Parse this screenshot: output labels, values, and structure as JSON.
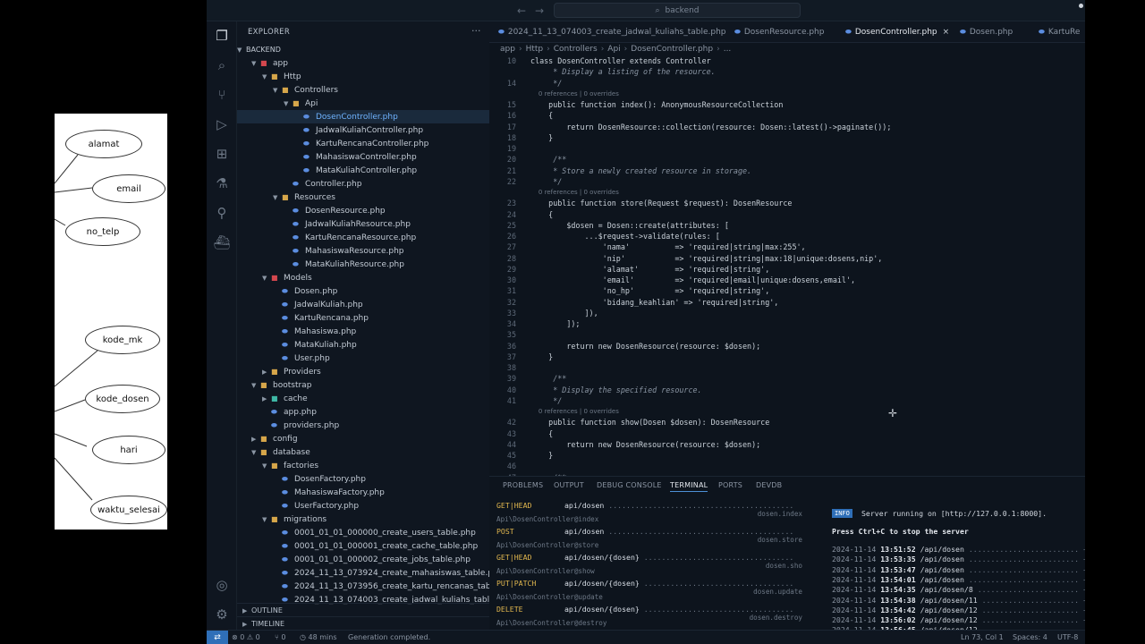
{
  "erd": {
    "attributes": [
      "alamat",
      "email",
      "no_telp",
      "kode_mk",
      "kode_dosen",
      "hari",
      "waktu_selesai"
    ]
  },
  "titlebar": {
    "search": "backend"
  },
  "explorer": {
    "title": "EXPLORER",
    "root": "BACKEND",
    "items": [
      {
        "label": "app",
        "type": "folder-red",
        "open": true
      },
      {
        "label": "Http",
        "type": "folder",
        "open": true
      },
      {
        "label": "Controllers",
        "type": "folder",
        "open": true
      },
      {
        "label": "Api",
        "type": "folder",
        "open": true
      },
      {
        "label": "DosenController.php",
        "type": "php",
        "selected": true
      },
      {
        "label": "JadwalKuliahController.php",
        "type": "php"
      },
      {
        "label": "KartuRencanaController.php",
        "type": "php"
      },
      {
        "label": "MahasiswaController.php",
        "type": "php"
      },
      {
        "label": "MataKuliahController.php",
        "type": "php"
      },
      {
        "label": "Controller.php",
        "type": "php"
      },
      {
        "label": "Resources",
        "type": "folder",
        "open": true
      },
      {
        "label": "DosenResource.php",
        "type": "php"
      },
      {
        "label": "JadwalKuliahResource.php",
        "type": "php"
      },
      {
        "label": "KartuRencanaResource.php",
        "type": "php"
      },
      {
        "label": "MahasiswaResource.php",
        "type": "php"
      },
      {
        "label": "MataKuliahResource.php",
        "type": "php"
      },
      {
        "label": "Models",
        "type": "folder-red",
        "open": true
      },
      {
        "label": "Dosen.php",
        "type": "php"
      },
      {
        "label": "JadwalKuliah.php",
        "type": "php"
      },
      {
        "label": "KartuRencana.php",
        "type": "php"
      },
      {
        "label": "Mahasiswa.php",
        "type": "php"
      },
      {
        "label": "MataKuliah.php",
        "type": "php"
      },
      {
        "label": "User.php",
        "type": "php"
      },
      {
        "label": "Providers",
        "type": "folder",
        "open": false
      },
      {
        "label": "bootstrap",
        "type": "folder",
        "open": true
      },
      {
        "label": "cache",
        "type": "folder-teal",
        "open": false
      },
      {
        "label": "app.php",
        "type": "php"
      },
      {
        "label": "providers.php",
        "type": "php"
      },
      {
        "label": "config",
        "type": "folder",
        "open": false
      },
      {
        "label": "database",
        "type": "folder",
        "open": true
      },
      {
        "label": "factories",
        "type": "folder",
        "open": true
      },
      {
        "label": "DosenFactory.php",
        "type": "php"
      },
      {
        "label": "MahasiswaFactory.php",
        "type": "php"
      },
      {
        "label": "UserFactory.php",
        "type": "php"
      },
      {
        "label": "migrations",
        "type": "folder",
        "open": true
      },
      {
        "label": "0001_01_01_000000_create_users_table.php",
        "type": "php"
      },
      {
        "label": "0001_01_01_000001_create_cache_table.php",
        "type": "php"
      },
      {
        "label": "0001_01_01_000002_create_jobs_table.php",
        "type": "php"
      },
      {
        "label": "2024_11_13_073924_create_mahasiswas_table.php",
        "type": "php"
      },
      {
        "label": "2024_11_13_073956_create_kartu_rencanas_table.php",
        "type": "php"
      },
      {
        "label": "2024_11_13_074003_create_jadwal_kuliahs_table.php",
        "type": "php"
      }
    ],
    "outline": "OUTLINE",
    "timeline": "TIMELINE"
  },
  "tabs": [
    {
      "label": "2024_11_13_074003_create_jadwal_kuliahs_table.php",
      "active": false
    },
    {
      "label": "DosenResource.php",
      "active": false
    },
    {
      "label": "DosenController.php",
      "active": true,
      "close": "×"
    },
    {
      "label": "Dosen.php",
      "active": false
    },
    {
      "label": "KartuRe",
      "active": false
    }
  ],
  "breadcrumb": [
    "app",
    "Http",
    "Controllers",
    "Api",
    "DosenController.php",
    "..."
  ],
  "code": [
    {
      "n": "10",
      "t": "class DosenController extends Controller",
      "k": "kw"
    },
    {
      "n": "",
      "t": "     * Display a listing of the resource.",
      "k": "comment"
    },
    {
      "n": "14",
      "t": "     */",
      "k": "comment"
    },
    {
      "n": "",
      "t": "    0 references | 0 overrides",
      "k": "meta"
    },
    {
      "n": "15",
      "t": "    public function index(): AnonymousResourceCollection",
      "k": "kw"
    },
    {
      "n": "16",
      "t": "    {",
      "k": ""
    },
    {
      "n": "17",
      "t": "        return DosenResource::collection(resource: Dosen::latest()->paginate());",
      "k": ""
    },
    {
      "n": "18",
      "t": "    }",
      "k": ""
    },
    {
      "n": "19",
      "t": "",
      "k": ""
    },
    {
      "n": "20",
      "t": "     /**",
      "k": "comment"
    },
    {
      "n": "21",
      "t": "     * Store a newly created resource in storage.",
      "k": "comment"
    },
    {
      "n": "22",
      "t": "     */",
      "k": "comment"
    },
    {
      "n": "",
      "t": "    0 references | 0 overrides",
      "k": "meta"
    },
    {
      "n": "23",
      "t": "    public function store(Request $request): DosenResource",
      "k": "kw"
    },
    {
      "n": "24",
      "t": "    {",
      "k": ""
    },
    {
      "n": "25",
      "t": "        $dosen = Dosen::create(attributes: [",
      "k": ""
    },
    {
      "n": "26",
      "t": "            ...$request->validate(rules: [",
      "k": ""
    },
    {
      "n": "27",
      "t": "                'nama'          => 'required|string|max:255',",
      "k": ""
    },
    {
      "n": "28",
      "t": "                'nip'           => 'required|string|max:18|unique:dosens,nip',",
      "k": ""
    },
    {
      "n": "29",
      "t": "                'alamat'        => 'required|string',",
      "k": ""
    },
    {
      "n": "30",
      "t": "                'email'         => 'required|email|unique:dosens,email',",
      "k": ""
    },
    {
      "n": "31",
      "t": "                'no_hp'         => 'required|string',",
      "k": ""
    },
    {
      "n": "32",
      "t": "                'bidang_keahlian' => 'required|string',",
      "k": ""
    },
    {
      "n": "33",
      "t": "            ]),",
      "k": ""
    },
    {
      "n": "34",
      "t": "        ]);",
      "k": ""
    },
    {
      "n": "35",
      "t": "",
      "k": ""
    },
    {
      "n": "36",
      "t": "        return new DosenResource(resource: $dosen);",
      "k": ""
    },
    {
      "n": "37",
      "t": "    }",
      "k": ""
    },
    {
      "n": "38",
      "t": "",
      "k": ""
    },
    {
      "n": "39",
      "t": "     /**",
      "k": "comment"
    },
    {
      "n": "40",
      "t": "     * Display the specified resource.",
      "k": "comment"
    },
    {
      "n": "41",
      "t": "     */",
      "k": "comment"
    },
    {
      "n": "",
      "t": "    0 references | 0 overrides",
      "k": "meta"
    },
    {
      "n": "42",
      "t": "    public function show(Dosen $dosen): DosenResource",
      "k": "kw"
    },
    {
      "n": "43",
      "t": "    {",
      "k": ""
    },
    {
      "n": "44",
      "t": "        return new DosenResource(resource: $dosen);",
      "k": ""
    },
    {
      "n": "45",
      "t": "    }",
      "k": ""
    },
    {
      "n": "46",
      "t": "",
      "k": ""
    },
    {
      "n": "47",
      "t": "     /**",
      "k": "comment"
    }
  ],
  "panel": {
    "tabs": [
      "PROBLEMS",
      "OUTPUT",
      "DEBUG CONSOLE",
      "TERMINAL",
      "PORTS",
      "DEVDB"
    ],
    "active": "TERMINAL",
    "routes": [
      {
        "method": "GET|HEAD",
        "path": "api/dosen",
        "dots": " ..........................................",
        "name": "dosen.index",
        "action": "Api\\DosenController@index"
      },
      {
        "method": "POST",
        "path": "api/dosen",
        "dots": " ..........................................",
        "name": "dosen.store",
        "action": "Api\\DosenController@store"
      },
      {
        "method": "GET|HEAD",
        "path": "api/dosen/{dosen}",
        "dots": " ..................................",
        "name": "dosen.sho",
        "action": "Api\\DosenController@show"
      },
      {
        "method": "PUT|PATCH",
        "path": "api/dosen/{dosen}",
        "dots": " ..................................",
        "name": "dosen.update",
        "action": "Api\\DosenController@update"
      },
      {
        "method": "DELETE",
        "path": "api/dosen/{dosen}",
        "dots": " ..................................",
        "name": "dosen.destroy",
        "action": "Api\\DosenController@destroy"
      }
    ]
  },
  "server": {
    "badge": "INFO",
    "running": "Server running on [http://127.0.0.1:8000].",
    "stop": "Press Ctrl+C to stop the server",
    "log": [
      {
        "date": "2024-11-14",
        "time": "13:51:52",
        "path": "/api/dosen",
        "dots": " ......................... ~ 503"
      },
      {
        "date": "2024-11-14",
        "time": "13:53:35",
        "path": "/api/dosen",
        "dots": " ......................... ~ 502"
      },
      {
        "date": "2024-11-14",
        "time": "13:53:47",
        "path": "/api/dosen",
        "dots": " ......................... ~ 0"
      },
      {
        "date": "2024-11-14",
        "time": "13:54:01",
        "path": "/api/dosen",
        "dots": " ......................... ~ 0"
      },
      {
        "date": "2024-11-14",
        "time": "13:54:35",
        "path": "/api/dosen/8",
        "dots": " ....................... ~ 0"
      },
      {
        "date": "2024-11-14",
        "time": "13:54:38",
        "path": "/api/dosen/11",
        "dots": " ...................... ~ 0"
      },
      {
        "date": "2024-11-14",
        "time": "13:54:42",
        "path": "/api/dosen/12",
        "dots": " ...................... ~ 0"
      },
      {
        "date": "2024-11-14",
        "time": "13:56:02",
        "path": "/api/dosen/12",
        "dots": " ...................... ~ 0"
      },
      {
        "date": "2024-11-14",
        "time": "13:56:45",
        "path": "/api/dosen/12",
        "dots": " ...................... ~ 0"
      }
    ]
  },
  "status": {
    "errors": "0",
    "warnings": "0",
    "ports": "0",
    "time": "48 mins",
    "message": "Generation completed.",
    "position": "Ln 73, Col 1",
    "spaces": "Spaces: 4",
    "encoding": "UTF-8"
  }
}
